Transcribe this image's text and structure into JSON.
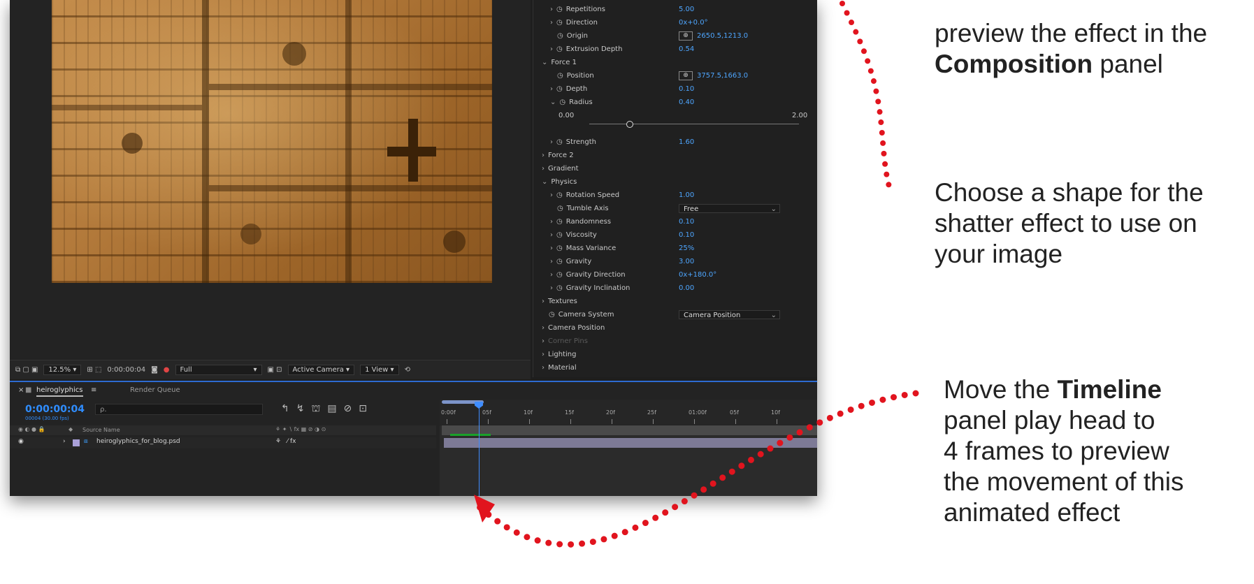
{
  "composition": {
    "zoom": "12.5%",
    "timecode": "0:00:00:04",
    "resolution": "Full",
    "view": "Active Camera",
    "view_count": "1 View"
  },
  "effects": {
    "rows": [
      {
        "indent": 2,
        "twirl": ">",
        "stopwatch": true,
        "label": "Repetitions",
        "value": "5.00"
      },
      {
        "indent": 2,
        "twirl": ">",
        "stopwatch": true,
        "label": "Direction",
        "value": "0x+0.0°"
      },
      {
        "indent": 2,
        "twirl": "",
        "stopwatch": true,
        "label": "Origin",
        "value": "2650.5,1213.0",
        "point": true
      },
      {
        "indent": 2,
        "twirl": ">",
        "stopwatch": true,
        "label": "Extrusion Depth",
        "value": "0.54"
      },
      {
        "indent": 1,
        "twirl": "v",
        "stopwatch": false,
        "label": "Force 1",
        "value": ""
      },
      {
        "indent": 2,
        "twirl": "",
        "stopwatch": true,
        "label": "Position",
        "value": "3757.5,1663.0",
        "point": true
      },
      {
        "indent": 2,
        "twirl": ">",
        "stopwatch": true,
        "label": "Depth",
        "value": "0.10"
      },
      {
        "indent": 2,
        "twirl": "v",
        "stopwatch": true,
        "label": "Radius",
        "value": "0.40"
      },
      {
        "indent": 3,
        "twirl": "",
        "stopwatch": false,
        "label": "0.00",
        "value": "",
        "right": "2.00"
      },
      {
        "indent": 2,
        "twirl": "",
        "stopwatch": false,
        "label": "",
        "value": "",
        "slider": true
      },
      {
        "indent": 2,
        "twirl": ">",
        "stopwatch": true,
        "label": "Strength",
        "value": "1.60"
      },
      {
        "indent": 1,
        "twirl": ">",
        "stopwatch": false,
        "label": "Force 2",
        "value": ""
      },
      {
        "indent": 1,
        "twirl": ">",
        "stopwatch": false,
        "label": "Gradient",
        "value": ""
      },
      {
        "indent": 1,
        "twirl": "v",
        "stopwatch": false,
        "label": "Physics",
        "value": ""
      },
      {
        "indent": 2,
        "twirl": ">",
        "stopwatch": true,
        "label": "Rotation Speed",
        "value": "1.00"
      },
      {
        "indent": 2,
        "twirl": "",
        "stopwatch": true,
        "label": "Tumble Axis",
        "value": "Free",
        "dropdown": true
      },
      {
        "indent": 2,
        "twirl": ">",
        "stopwatch": true,
        "label": "Randomness",
        "value": "0.10"
      },
      {
        "indent": 2,
        "twirl": ">",
        "stopwatch": true,
        "label": "Viscosity",
        "value": "0.10"
      },
      {
        "indent": 2,
        "twirl": ">",
        "stopwatch": true,
        "label": "Mass Variance",
        "value": "25%"
      },
      {
        "indent": 2,
        "twirl": ">",
        "stopwatch": true,
        "label": "Gravity",
        "value": "3.00"
      },
      {
        "indent": 2,
        "twirl": ">",
        "stopwatch": true,
        "label": "Gravity Direction",
        "value": "0x+180.0°"
      },
      {
        "indent": 2,
        "twirl": ">",
        "stopwatch": true,
        "label": "Gravity Inclination",
        "value": "0.00"
      },
      {
        "indent": 1,
        "twirl": ">",
        "stopwatch": false,
        "label": "Textures",
        "value": ""
      },
      {
        "indent": 1,
        "twirl": "",
        "stopwatch": true,
        "label": "Camera System",
        "value": "Camera Position",
        "dropdown": true
      },
      {
        "indent": 1,
        "twirl": ">",
        "stopwatch": false,
        "label": "Camera Position",
        "value": ""
      },
      {
        "indent": 1,
        "twirl": ">",
        "stopwatch": false,
        "label": "Corner Pins",
        "value": "",
        "disabled": true
      },
      {
        "indent": 1,
        "twirl": ">",
        "stopwatch": false,
        "label": "Lighting",
        "value": ""
      },
      {
        "indent": 1,
        "twirl": ">",
        "stopwatch": false,
        "label": "Material",
        "value": ""
      }
    ]
  },
  "timeline": {
    "tab_comp": "heiroglyphics",
    "tab_render": "Render Queue",
    "time": "0:00:00:04",
    "time_sub": "00004 (30.00 fps)",
    "search_placeholder": "ρ.",
    "header_source_name": "Source Name",
    "layer_name": "heiroglyphics_for_blog.psd",
    "ruler_ticks": [
      "0:00f",
      "05f",
      "10f",
      "15f",
      "20f",
      "25f",
      "01:00f",
      "05f",
      "10f"
    ]
  },
  "annotations": {
    "note1_line1": "preview the effect in the",
    "note1_bold": "Composition",
    "note1_rest": " panel",
    "note2_line1": "Choose a shape for the",
    "note2_line2": "shatter effect to use on",
    "note2_line3": "your image",
    "note3_pre": "Move the ",
    "note3_bold": "Timeline",
    "note3_line2": "panel play head to",
    "note3_line3": "4 frames to preview",
    "note3_line4": "the movement of this",
    "note3_line5": "animated effect",
    "dot_color": "#e1141e"
  }
}
